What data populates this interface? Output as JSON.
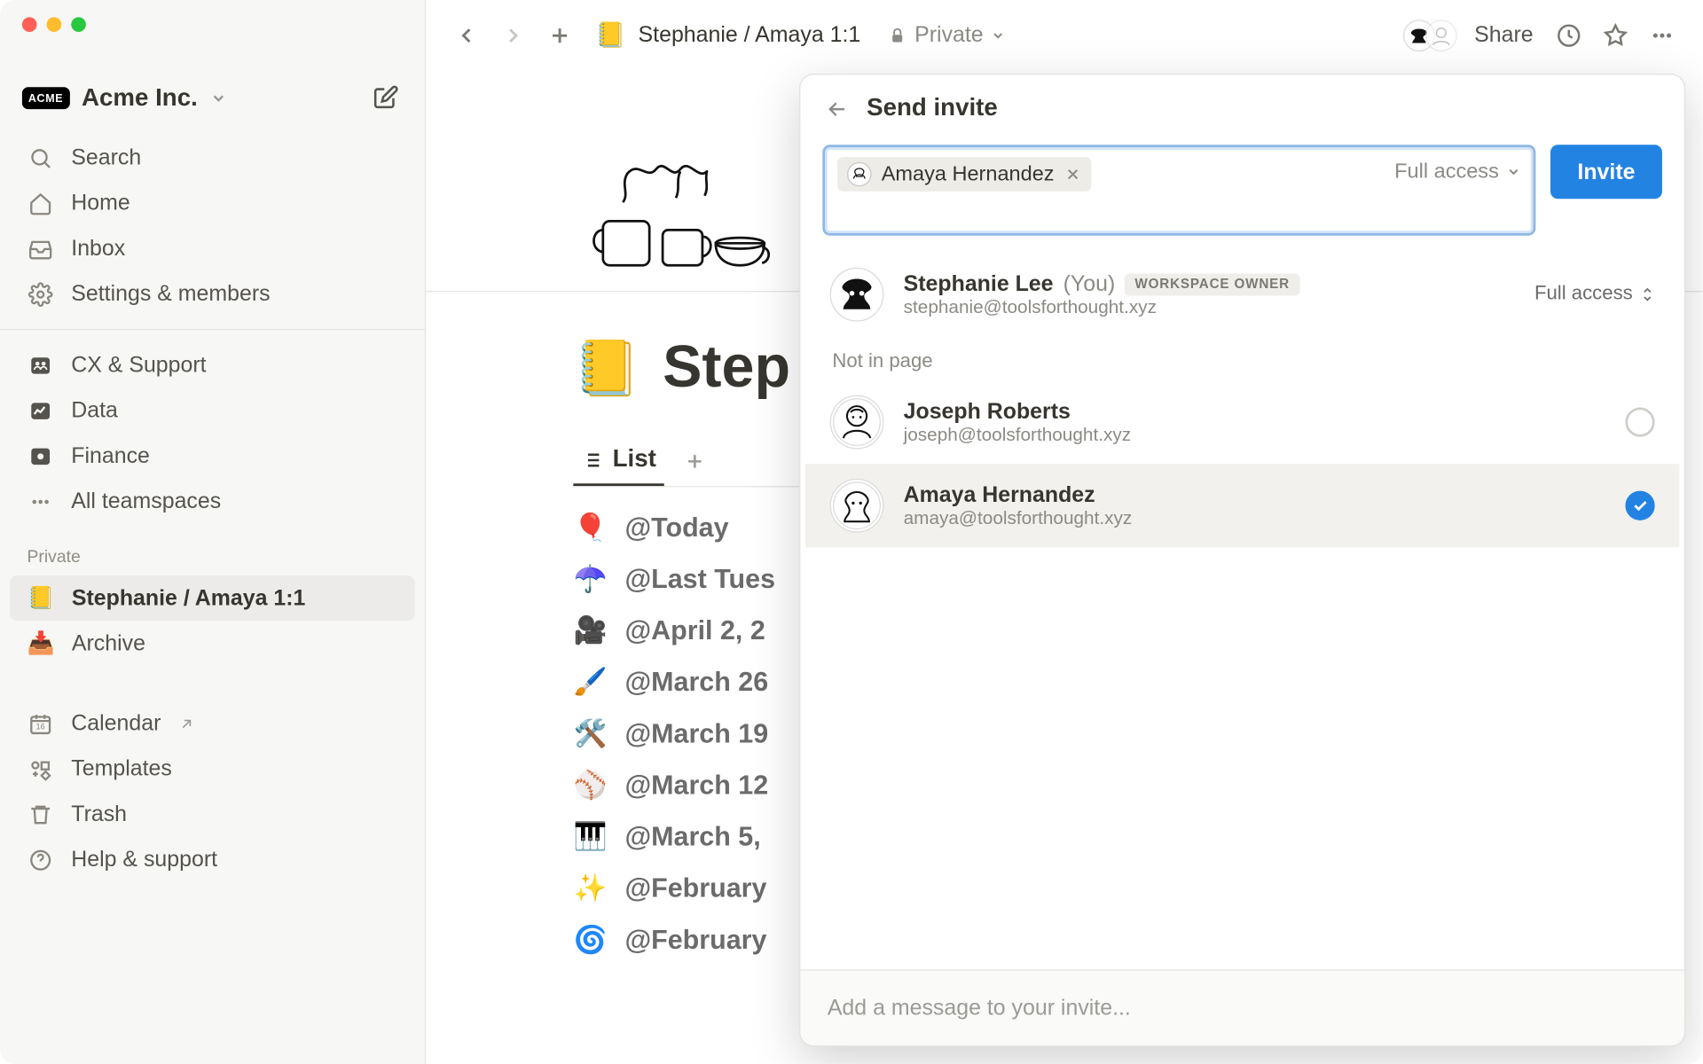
{
  "workspace": {
    "name": "Acme Inc.",
    "logo_text": "ACME"
  },
  "sidebar": {
    "nav": [
      {
        "label": "Search"
      },
      {
        "label": "Home"
      },
      {
        "label": "Inbox"
      },
      {
        "label": "Settings & members"
      }
    ],
    "teamspaces": [
      {
        "label": "CX & Support"
      },
      {
        "label": "Data"
      },
      {
        "label": "Finance"
      },
      {
        "label": "All teamspaces"
      }
    ],
    "private_label": "Private",
    "private_pages": [
      {
        "emoji": "📒",
        "label": "Stephanie / Amaya 1:1",
        "selected": true
      },
      {
        "emoji": "📥",
        "label": "Archive",
        "selected": false
      }
    ],
    "bottom": [
      {
        "label": "Calendar",
        "external": true
      },
      {
        "label": "Templates"
      },
      {
        "label": "Trash"
      },
      {
        "label": "Help & support"
      }
    ]
  },
  "topbar": {
    "crumb_emoji": "📒",
    "crumb": "Stephanie / Amaya 1:1",
    "privacy": "Private",
    "share": "Share"
  },
  "page": {
    "title_emoji": "📒",
    "title": "Step",
    "view_tab": "List",
    "items": [
      {
        "emoji": "🎈",
        "label": "@Today"
      },
      {
        "emoji": "☂️",
        "label": "@Last Tues"
      },
      {
        "emoji": "🎥",
        "label": "@April 2, 2"
      },
      {
        "emoji": "🖌️",
        "label": "@March 26"
      },
      {
        "emoji": "🛠️",
        "label": "@March 19"
      },
      {
        "emoji": "⚾️",
        "label": "@March 12"
      },
      {
        "emoji": "🎹",
        "label": "@March 5,"
      },
      {
        "emoji": "✨",
        "label": "@February"
      },
      {
        "emoji": "🌀",
        "label": "@February"
      }
    ]
  },
  "invite": {
    "header": "Send invite",
    "chip_name": "Amaya Hernandez",
    "permission": "Full access",
    "button": "Invite",
    "me": {
      "name": "Stephanie Lee",
      "you": "(You)",
      "badge": "WORKSPACE OWNER",
      "email": "stephanie@toolsforthought.xyz",
      "perm": "Full access"
    },
    "section_label": "Not in page",
    "suggestions": [
      {
        "name": "Joseph Roberts",
        "email": "joseph@toolsforthought.xyz",
        "selected": false
      },
      {
        "name": "Amaya Hernandez",
        "email": "amaya@toolsforthought.xyz",
        "selected": true
      }
    ],
    "message_placeholder": "Add a message to your invite..."
  }
}
